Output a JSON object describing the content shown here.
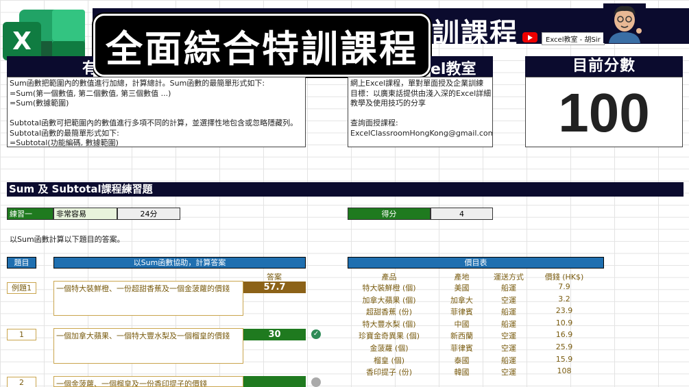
{
  "header": {
    "banner_title": "訓課程",
    "channel_label": "Excel教室 - 胡Sir",
    "big_title": "全面綜合特訓課程"
  },
  "sections": {
    "about_heading": "有",
    "classroom_heading": "el教室",
    "score_heading": "目前分數"
  },
  "description_text": "Sum函數把範圍內的數值進行加總，計算總計。Sum函數的最簡單形式如下:\n=Sum(第一個數值, 第二個數值, 第三個數值 ...)\n=Sum(數據範圍)\n\nSubtotal函數可把範圍內的數值進行多項不同的計算，並選擇性地包含或忽略隱藏列。\nSubtotal函數的最簡單形式如下:\n=Subtotal(功能編碼, 數據範圍)",
  "info_text": "網上Excel課程，單對單面授及企業訓練\n目標：以廣東話提供由淺入深的Excel詳細\n教學及使用技巧的分享\n\n查詢面授課程:\nExcelClassroomHongKong@gmail.com",
  "current_score": "100",
  "practice_title": "Sum 及 Subtotal課程練習題",
  "exercise": {
    "label": "練習一",
    "difficulty": "非常容易",
    "points": "24分",
    "score_label": "得分",
    "score_value": "4"
  },
  "instruction": "以Sum函數計算以下題目的答案。",
  "question_table": {
    "col_number": "題目",
    "col_task": "以Sum函數協助，計算答案",
    "col_answer": "答案",
    "rows": [
      {
        "num": "例題1",
        "text": "一個特大裝鮮橙、一份超甜香蕉及一個金菠蘿的價錢",
        "answer": "57.7"
      },
      {
        "num": "1",
        "text": "一個加拿大蘋果、一個特大豐水梨及一個榴皇的價錢",
        "answer": "30"
      },
      {
        "num": "2",
        "text": "一個金菠蘿、一個榴皇及一份香印提子的價錢",
        "answer": ""
      }
    ]
  },
  "price_table": {
    "title": "價目表",
    "headers": [
      "產品",
      "產地",
      "運送方式",
      "價錢 (HK$)"
    ],
    "rows": [
      [
        "特大裝鮮橙 (個)",
        "美國",
        "船運",
        "7.9"
      ],
      [
        "加拿大蘋果 (個)",
        "加拿大",
        "空運",
        "3.2"
      ],
      [
        "超甜香蕉 (份)",
        "菲律賓",
        "船運",
        "23.9"
      ],
      [
        "特大豐水梨 (個)",
        "中國",
        "船運",
        "10.9"
      ],
      [
        "珍寶金奇異果 (個)",
        "新西蘭",
        "空運",
        "16.9"
      ],
      [
        "金菠蘿 (個)",
        "菲律賓",
        "空運",
        "25.9"
      ],
      [
        "榴皇 (個)",
        "泰國",
        "船運",
        "15.9"
      ],
      [
        "香印提子 (份)",
        "韓國",
        "空運",
        "108"
      ]
    ]
  },
  "icons": {
    "app_logo": "excel-logo-icon",
    "video": "youtube-icon",
    "correct": "check-circle-icon",
    "pending": "pending-circle-icon"
  },
  "colors": {
    "navy": "#0b0b2e",
    "green": "#1f7a1f",
    "blue": "#1f6fb0",
    "brown": "#8c6218"
  }
}
